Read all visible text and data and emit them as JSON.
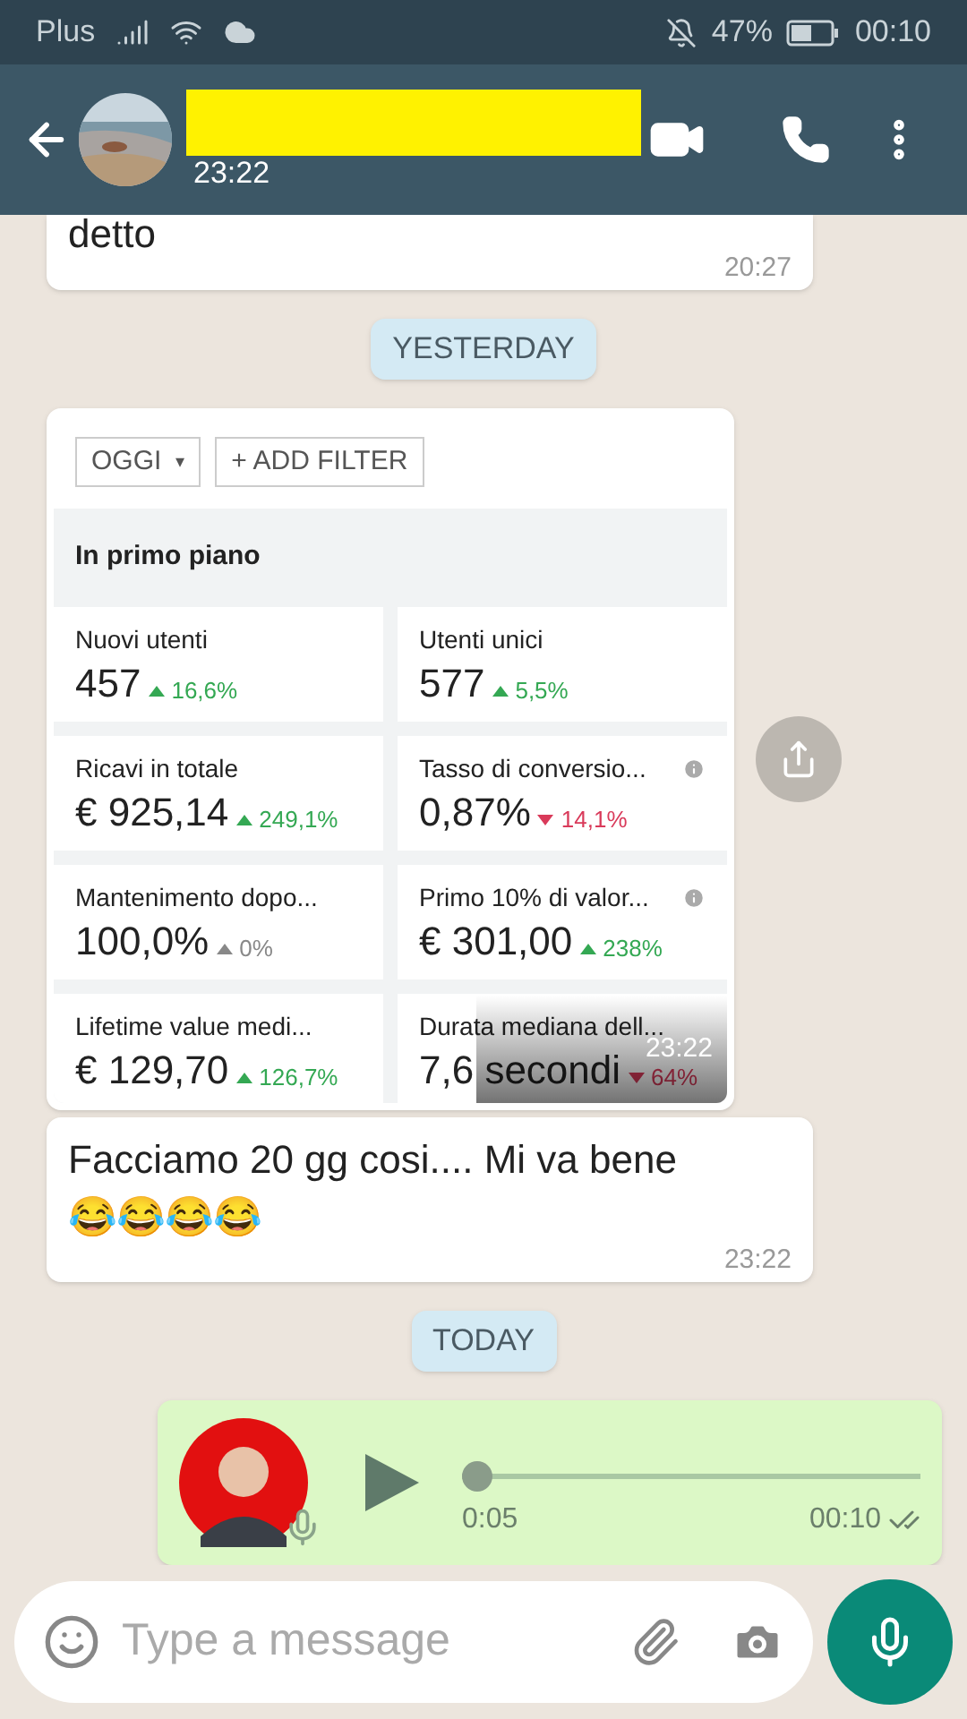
{
  "status_bar": {
    "carrier": "Plus",
    "battery": "47%",
    "time": "00:10"
  },
  "header": {
    "name_redacted": true,
    "last_seen": "23:22"
  },
  "messages": [
    {
      "kind": "text",
      "text": "detto",
      "time": "20:27",
      "cut_top": true
    },
    {
      "kind": "date",
      "text": "YESTERDAY"
    },
    {
      "time": "23:22",
      "screenshot": {
        "filter": "OGGI",
        "filter_icon": "▾",
        "add_filter": "+ ADD FILTER",
        "section": "In primo piano",
        "metrics": [
          {
            "label": "Nuovi utenti",
            "value": "457",
            "change": "16,6%",
            "kind": "up",
            "info": false
          },
          {
            "label": "Utenti unici",
            "value": "577",
            "change": "5,5%",
            "kind": "up",
            "info": false
          },
          {
            "label": "Ricavi in totale",
            "value": "€ 925,14",
            "change": "249,1%",
            "kind": "up",
            "info": false
          },
          {
            "label": "Tasso di conversio...",
            "value": "0,87%",
            "change": "14,1%",
            "kind": "down",
            "info": true
          },
          {
            "label": "Mantenimento dopo...",
            "value": "100,0%",
            "change": "0%",
            "kind": "flat",
            "info": false
          },
          {
            "label": "Primo 10% di valor...",
            "value": "€ 301,00",
            "change": "238%",
            "kind": "up",
            "info": true
          },
          {
            "label": "Lifetime value medi...",
            "value": "€ 129,70",
            "change": "126,7%",
            "kind": "up",
            "info": false
          },
          {
            "label": "Durata mediana dell...",
            "value": "7,6 secondi",
            "change": "64%",
            "kind": "down",
            "info": false
          }
        ]
      }
    },
    {
      "kind": "text",
      "text": "Facciamo 20 gg cosi.... Mi va bene 😂😂😂😂",
      "time": "23:22",
      "cut_top": false
    },
    {
      "kind": "date",
      "text": "TODAY"
    },
    {
      "kind": "voice",
      "level": 0,
      "position": "0:05",
      "time": "00:10"
    }
  ],
  "composer": {
    "placeholder": "Type a message"
  }
}
